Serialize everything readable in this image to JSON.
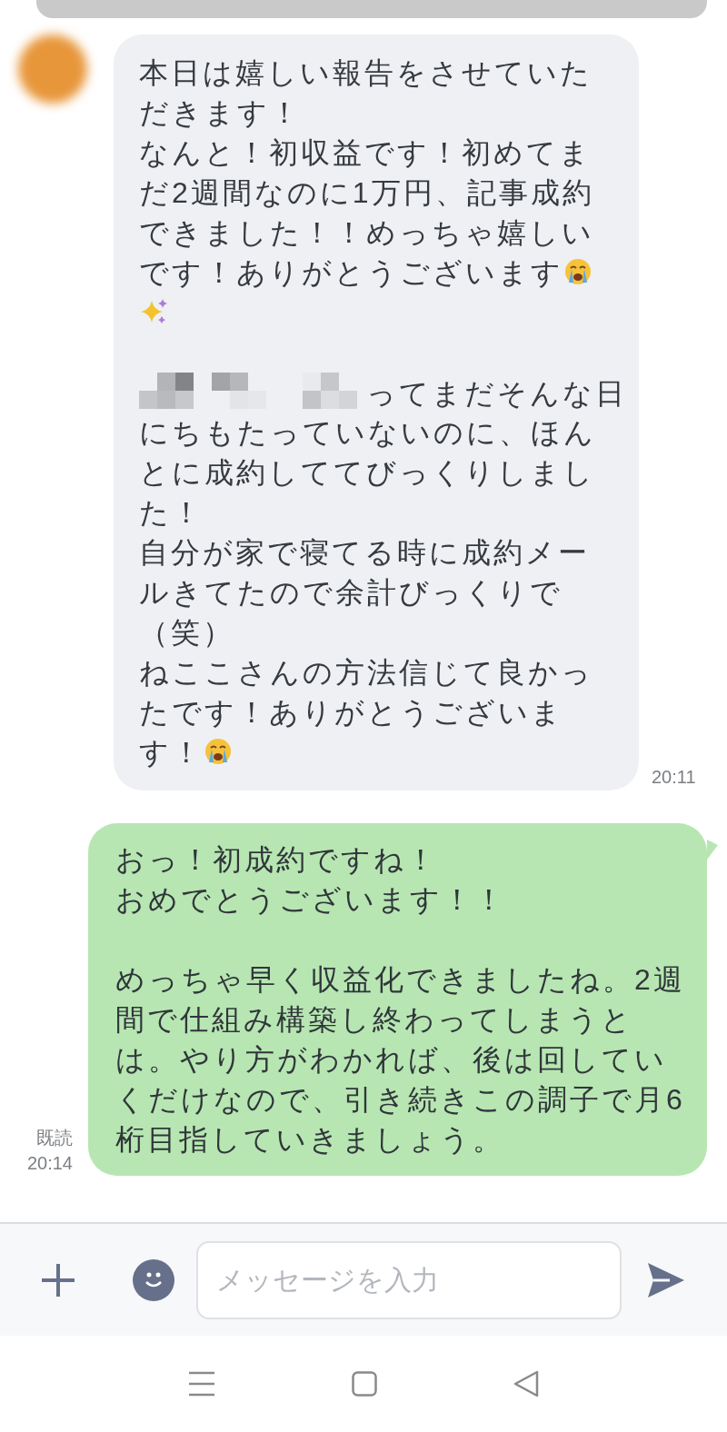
{
  "messages": [
    {
      "kind": "incoming",
      "time": "20:11",
      "paragraphs": [
        [
          [
            {
              "kind": "text",
              "text": "本日は嬉しい報告をさせていた"
            }
          ],
          [
            {
              "kind": "text",
              "text": "だきます！"
            }
          ],
          [
            {
              "kind": "text",
              "text": "なんと！初収益です！初めてま"
            }
          ],
          [
            {
              "kind": "text",
              "text": "だ2週間なのに1万円、記事成約"
            }
          ],
          [
            {
              "kind": "text",
              "text": "できました！！めっちゃ嬉しい"
            }
          ],
          [
            {
              "kind": "text",
              "text": "です！ありがとうございます"
            },
            {
              "kind": "crying_face"
            }
          ],
          [
            {
              "kind": "sparkles"
            }
          ]
        ],
        [
          [
            {
              "kind": "mosaic"
            },
            {
              "kind": "text",
              "text": "ってまだそんな日"
            }
          ],
          [
            {
              "kind": "text",
              "text": "にちもたっていないのに、ほん"
            }
          ],
          [
            {
              "kind": "text",
              "text": "とに成約しててびっくりしまし"
            }
          ],
          [
            {
              "kind": "text",
              "text": "た！"
            }
          ],
          [
            {
              "kind": "text",
              "text": "自分が家で寝てる時に成約メー"
            }
          ],
          [
            {
              "kind": "text",
              "text": "ルきてたので余計びっくりで"
            }
          ],
          [
            {
              "kind": "text",
              "text": "（笑）"
            }
          ],
          [
            {
              "kind": "text",
              "text": "ねここさんの方法信じて良かっ"
            }
          ],
          [
            {
              "kind": "text",
              "text": "たです！ありがとうございま"
            }
          ],
          [
            {
              "kind": "text",
              "text": "す！"
            },
            {
              "kind": "crying_face"
            }
          ]
        ]
      ]
    },
    {
      "kind": "outgoing",
      "read_label": "既読",
      "time": "20:14",
      "paragraphs": [
        [
          [
            {
              "kind": "text",
              "text": "おっ！初成約ですね！"
            }
          ],
          [
            {
              "kind": "text",
              "text": "おめでとうございます！！"
            }
          ]
        ],
        [
          [
            {
              "kind": "text",
              "text": "めっちゃ早く収益化できましたね。2週"
            }
          ],
          [
            {
              "kind": "text",
              "text": "間で仕組み構築し終わってしまうと"
            }
          ],
          [
            {
              "kind": "text",
              "text": "は。やり方がわかれば、後は回してい"
            }
          ],
          [
            {
              "kind": "text",
              "text": "くだけなので、引き続きこの調子で月6"
            }
          ],
          [
            {
              "kind": "text",
              "text": "桁目指していきましょう。"
            }
          ]
        ]
      ]
    }
  ],
  "composer": {
    "placeholder": "メッセージを入力"
  }
}
